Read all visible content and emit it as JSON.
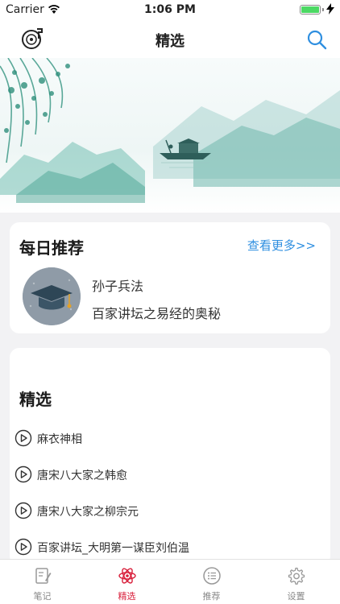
{
  "status_bar": {
    "carrier": "Carrier",
    "time": "1:06 PM"
  },
  "nav": {
    "title": "精选",
    "left_icon": "vinyl-record-icon",
    "right_icon": "search-icon",
    "accent_color": "#2f8fe0"
  },
  "banner": {
    "pages": 2,
    "active_page": 1,
    "active_dot_color": "#f08a24",
    "inactive_dot_color": "#ffffff"
  },
  "daily": {
    "title": "每日推荐",
    "more_label": "查看更多>>",
    "avatar_icon": "graduation-cap-icon",
    "line1": "孙子兵法",
    "line2": "百家讲坛之易经的奥秘"
  },
  "featured": {
    "title": "精选",
    "items": [
      {
        "label": "麻衣神相",
        "icon": "play-circle-icon"
      },
      {
        "label": "唐宋八大家之韩愈",
        "icon": "play-circle-icon"
      },
      {
        "label": "唐宋八大家之柳宗元",
        "icon": "play-circle-icon"
      },
      {
        "label": "百家讲坛_大明第一谋臣刘伯温",
        "icon": "play-circle-icon"
      }
    ]
  },
  "tabs": [
    {
      "label": "笔记",
      "icon": "notebook-icon",
      "active": false
    },
    {
      "label": "精选",
      "icon": "atom-icon",
      "active": true
    },
    {
      "label": "推荐",
      "icon": "list-icon",
      "active": false
    },
    {
      "label": "设置",
      "icon": "gear-icon",
      "active": false
    }
  ],
  "colors": {
    "tab_active": "#d81e3a",
    "tab_inactive": "#888888",
    "link": "#2f8fe0"
  }
}
